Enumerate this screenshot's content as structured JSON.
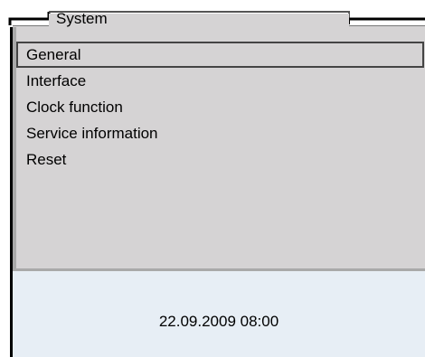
{
  "header": {
    "title": "System"
  },
  "menu": {
    "selected_index": 0,
    "items": [
      {
        "label": "General"
      },
      {
        "label": "Interface"
      },
      {
        "label": "Clock function"
      },
      {
        "label": "Service information"
      },
      {
        "label": "Reset"
      }
    ]
  },
  "status": {
    "datetime": "22.09.2009 08:00"
  }
}
